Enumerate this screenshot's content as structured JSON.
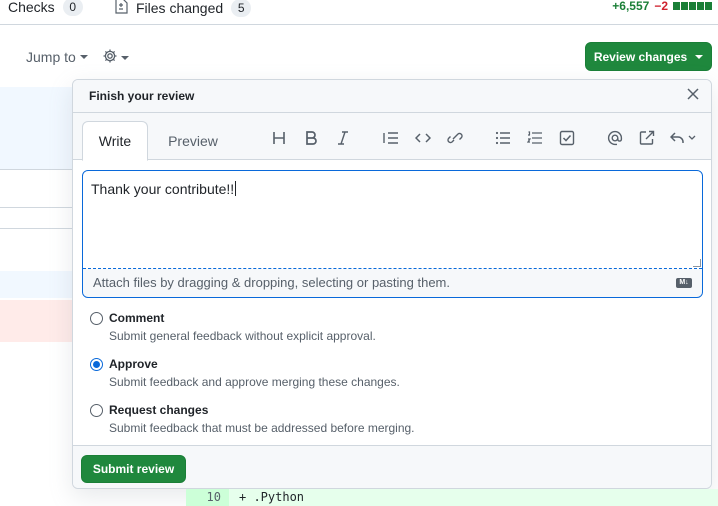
{
  "tabs": {
    "checks": {
      "label": "Checks",
      "count": "0"
    },
    "files_changed": {
      "label": "Files changed",
      "count": "5"
    }
  },
  "diffstat": {
    "additions": "+6,557",
    "deletions": "−2"
  },
  "toolbar": {
    "jump_to": "Jump to",
    "review_changes": "Review changes"
  },
  "dialog": {
    "title": "Finish your review",
    "tabs": {
      "write": "Write",
      "preview": "Preview"
    },
    "editor": {
      "value": "Thank your contribute!!",
      "attach_hint": "Attach files by dragging & dropping, selecting or pasting them."
    },
    "options": [
      {
        "label": "Comment",
        "description": "Submit general feedback without explicit approval.",
        "checked": false
      },
      {
        "label": "Approve",
        "description": "Submit feedback and approve merging these changes.",
        "checked": true
      },
      {
        "label": "Request changes",
        "description": "Submit feedback that must be addressed before merging.",
        "checked": false
      }
    ],
    "submit": "Submit review"
  },
  "diff": {
    "line_number": "10",
    "code": "+ .Python"
  },
  "colors": {
    "primary_green": "#1f883d",
    "focus_blue": "#0969da"
  },
  "icons": [
    "file-diff-icon",
    "chevron-down-icon",
    "gear-icon",
    "close-icon",
    "heading-icon",
    "bold-icon",
    "italic-icon",
    "quote-icon",
    "code-icon",
    "link-icon",
    "unordered-list-icon",
    "ordered-list-icon",
    "task-list-icon",
    "mention-icon",
    "reference-icon",
    "reply-icon",
    "markdown-icon"
  ]
}
